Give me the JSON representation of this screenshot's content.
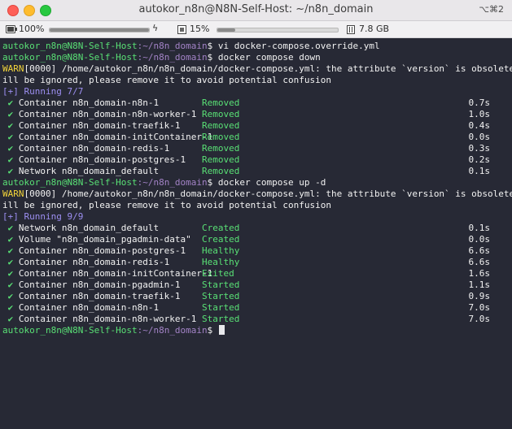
{
  "window": {
    "title": "autokor_n8n@N8N-Self-Host: ~/n8n_domain",
    "shortcut": "⌥⌘2"
  },
  "statusbar": {
    "battery": "100%",
    "battery_level": 1.0,
    "cpu": "15%",
    "cpu_level": 0.15,
    "memory": "7.8 GB"
  },
  "terminal": {
    "prompt_user": "autokor_n8n@N8N-Self-Host",
    "prompt_path": ":~/n8n_domain",
    "prompt_symbol": "$ ",
    "cmd1": "vi docker-compose.override.yml",
    "cmd2": "docker compose down",
    "warn_tag": "WARN",
    "warn1_rest_line1": "[0000] /home/autokor_n8n/n8n_domain/docker-compose.yml: the attribute `version` is obsolete, it w",
    "warn1_line2": "ill be ignored, please remove it to avoid potential confusion",
    "running1": "[+] Running 7/7",
    "down_rows": [
      {
        "name": "Container n8n_domain-n8n-1",
        "status": "Removed",
        "time": "0.7s"
      },
      {
        "name": "Container n8n_domain-n8n-worker-1",
        "status": "Removed",
        "time": "1.0s"
      },
      {
        "name": "Container n8n_domain-traefik-1",
        "status": "Removed",
        "time": "0.4s"
      },
      {
        "name": "Container n8n_domain-initContainer-1",
        "status": "Removed",
        "time": "0.0s"
      },
      {
        "name": "Container n8n_domain-redis-1",
        "status": "Removed",
        "time": "0.3s"
      },
      {
        "name": "Container n8n_domain-postgres-1",
        "status": "Removed",
        "time": "0.2s"
      },
      {
        "name": "Network n8n_domain_default",
        "status": "Removed",
        "time": "0.1s"
      }
    ],
    "cmd3": "docker compose up -d",
    "warn2_rest_line1": "[0000] /home/autokor_n8n/n8n_domain/docker-compose.yml: the attribute `version` is obsolete, it w",
    "warn2_line2": "ill be ignored, please remove it to avoid potential confusion",
    "running2": "[+] Running 9/9",
    "up_rows": [
      {
        "name": "Network n8n_domain_default",
        "status": "Created",
        "time": "0.1s"
      },
      {
        "name": "Volume \"n8n_domain_pgadmin-data\"",
        "status": "Created",
        "time": "0.0s"
      },
      {
        "name": "Container n8n_domain-postgres-1",
        "status": "Healthy",
        "time": "6.6s"
      },
      {
        "name": "Container n8n_domain-redis-1",
        "status": "Healthy",
        "time": "6.6s"
      },
      {
        "name": "Container n8n_domain-initContainer-1",
        "status": "Exited",
        "time": "1.6s"
      },
      {
        "name": "Container n8n_domain-pgadmin-1",
        "status": "Started",
        "time": "1.1s"
      },
      {
        "name": "Container n8n_domain-traefik-1",
        "status": "Started",
        "time": "0.9s"
      },
      {
        "name": "Container n8n_domain-n8n-1",
        "status": "Started",
        "time": "7.0s"
      },
      {
        "name": "Container n8n_domain-n8n-worker-1",
        "status": "Started",
        "time": "7.0s"
      }
    ],
    "check_glyph": "✔"
  },
  "colors": {
    "terminal_bg": "#272935",
    "prompt_green": "#59e075",
    "path_purple": "#a383c7",
    "warn_yellow": "#f2d43a",
    "running_violet": "#9d8ff2"
  }
}
